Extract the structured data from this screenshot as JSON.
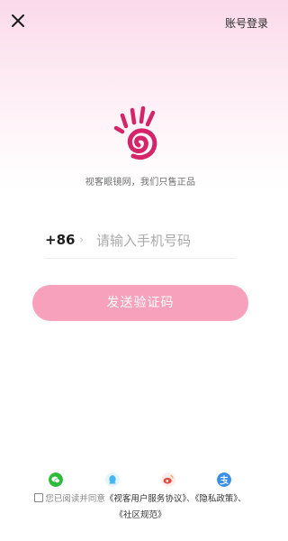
{
  "header": {
    "account_login": "账号登录"
  },
  "brand": {
    "slogan": "视客眼镜网，我们只售正品",
    "accent": "#d6246b"
  },
  "form": {
    "country_code": "+86",
    "chevron": "›",
    "phone_placeholder": "请输入手机号码",
    "send_code_label": "发送验证码",
    "button_color": "#f7a1bd"
  },
  "social": [
    {
      "icon": "wechat-icon",
      "color": "#2dbb3c"
    },
    {
      "icon": "qq-icon",
      "color": "#46b6f0"
    },
    {
      "icon": "weibo-icon",
      "color": "#e6483d"
    },
    {
      "icon": "alipay-icon",
      "color": "#3a8fe6"
    }
  ],
  "agreement": {
    "prefix": "您已阅读并同意",
    "user_agreement": "《视客用户服务协议》",
    "sep1": "、",
    "privacy_policy": "《隐私政策》",
    "sep2": "、",
    "community_rules": "《社区规范》"
  }
}
